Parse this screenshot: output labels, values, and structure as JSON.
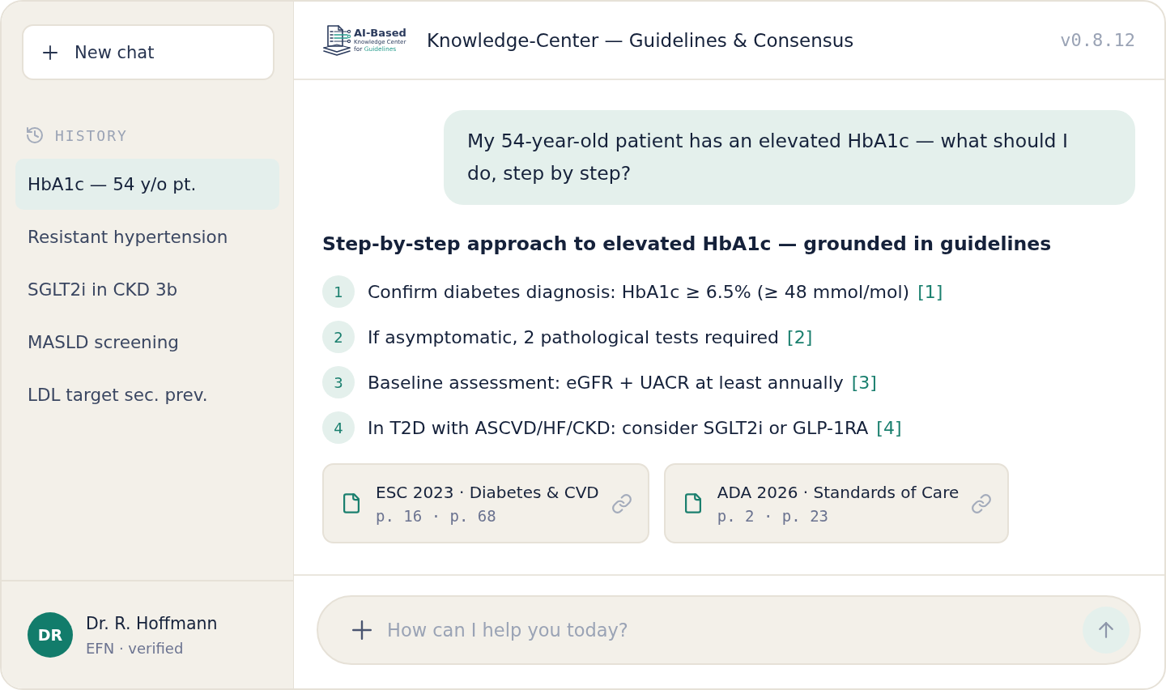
{
  "sidebar": {
    "new_chat_label": "New chat",
    "history": {
      "heading": "HISTORY",
      "items": [
        {
          "label": "HbA1c — 54 y/o pt.",
          "selected": true
        },
        {
          "label": "Resistant hypertension",
          "selected": false
        },
        {
          "label": "SGLT2i in CKD 3b",
          "selected": false
        },
        {
          "label": "MASLD screening",
          "selected": false
        },
        {
          "label": "LDL target sec. prev.",
          "selected": false
        }
      ]
    },
    "user": {
      "initials": "DR",
      "name": "Dr. R. Hoffmann",
      "subtitle": "EFN · verified"
    }
  },
  "header": {
    "logo": {
      "title": "AI-Based",
      "subtitle": "Knowledge Center",
      "tagline_prefix": "for",
      "tagline_accent": "Guidelines"
    },
    "title": "Knowledge-Center — Guidelines & Consensus",
    "version": "v0.8.12"
  },
  "conversation": {
    "user_message": "My 54-year-old patient has an elevated HbA1c — what should I do, step by step?",
    "answer": {
      "heading": "Step-by-step approach to elevated HbA1c — grounded in guidelines",
      "steps": [
        {
          "number": "1",
          "text": "Confirm diabetes diagnosis: HbA1c ≥ 6.5% (≥ 48 mmol/mol)",
          "citation": "[1]"
        },
        {
          "number": "2",
          "text": "If asymptomatic, 2 pathological tests required",
          "citation": "[2]"
        },
        {
          "number": "3",
          "text": "Baseline assessment: eGFR + UACR at least annually",
          "citation": "[3]"
        },
        {
          "number": "4",
          "text": "In T2D with ASCVD/HF/CKD: consider SGLT2i or GLP-1RA",
          "citation": "[4]"
        }
      ],
      "sources": [
        {
          "title": "ESC 2023 · Diabetes & CVD",
          "pages": "p. 16 · p. 68"
        },
        {
          "title": "ADA 2026 · Standards of Care",
          "pages": "p. 2 · p. 23"
        }
      ]
    }
  },
  "composer": {
    "placeholder": "How can I help you today?"
  }
}
